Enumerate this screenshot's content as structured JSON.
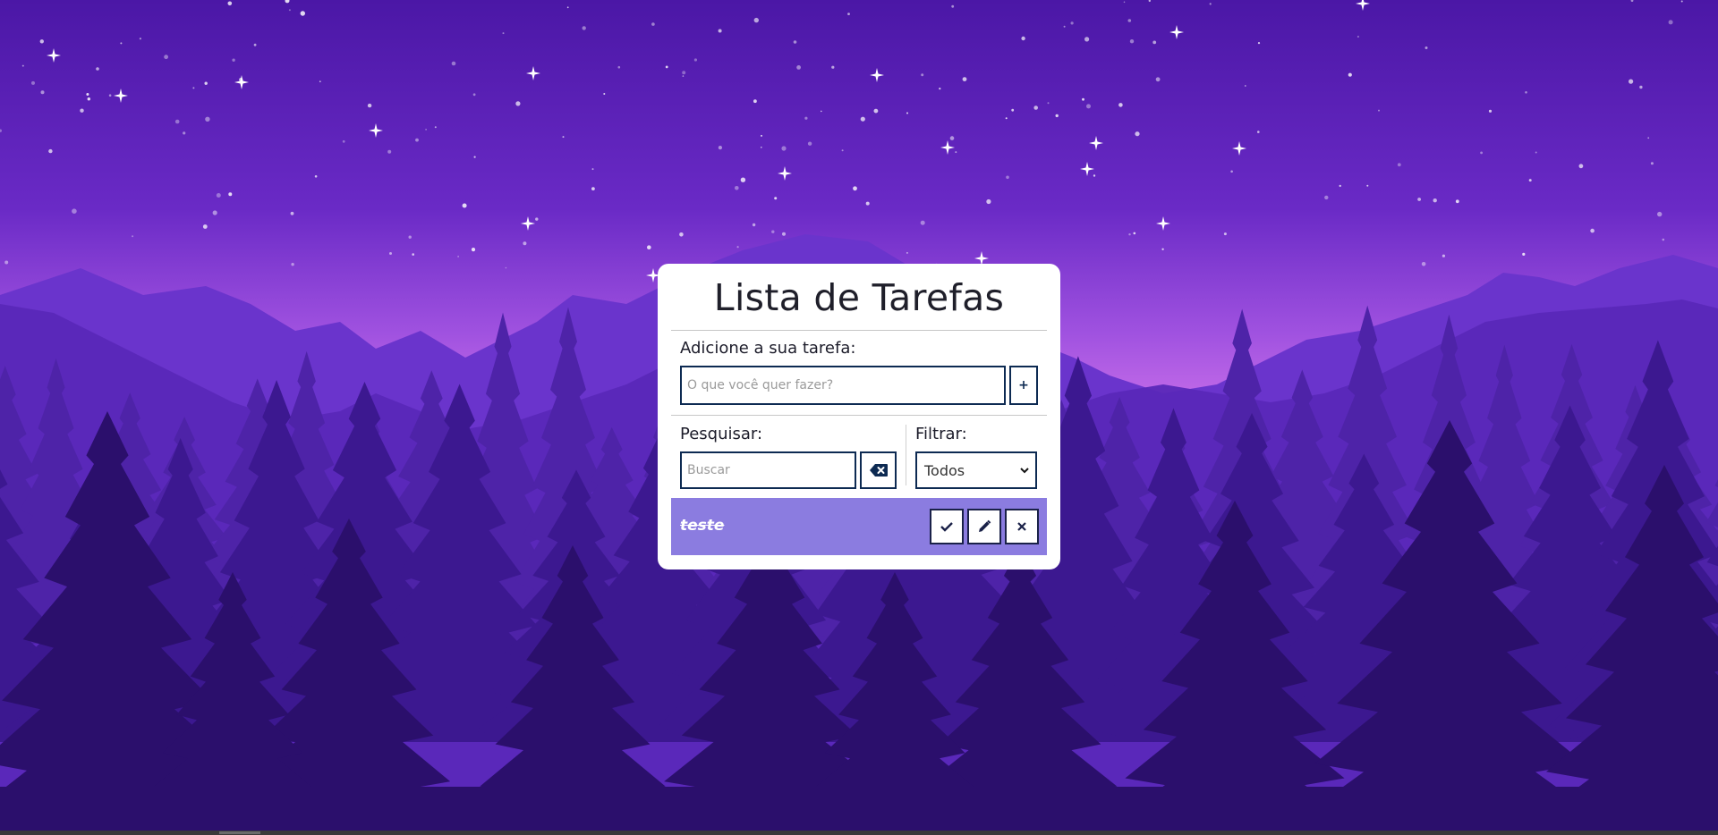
{
  "app": {
    "title": "Lista de Tarefas"
  },
  "add_section": {
    "label": "Adicione a sua tarefa:",
    "input_value": "",
    "input_placeholder": "O que você quer fazer?",
    "add_button_label": "+"
  },
  "search_section": {
    "label": "Pesquisar:",
    "input_value": "",
    "input_placeholder": "Buscar",
    "clear_icon": "backspace-icon"
  },
  "filter_section": {
    "label": "Filtrar:",
    "selected": "Todos"
  },
  "todos": [
    {
      "text": "teste",
      "done": true,
      "actions": [
        "check-icon",
        "pencil-icon",
        "close-icon"
      ]
    }
  ],
  "colors": {
    "card_bg": "#ffffff",
    "border": "#0d2a52",
    "todo_bg": "#8b7ce0",
    "sky_top": "#4a18a8",
    "sky_glow": "#b05ee6",
    "forest_dark": "#2a0f66"
  }
}
